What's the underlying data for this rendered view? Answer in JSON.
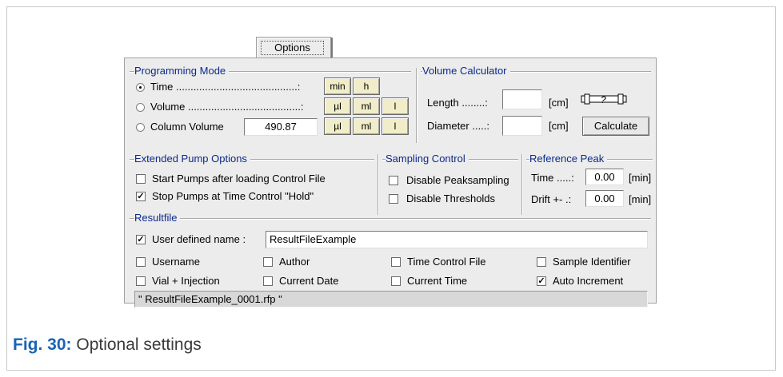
{
  "tab": {
    "label": "Options"
  },
  "programming_mode": {
    "title": "Programming Mode",
    "time_label": "Time ..........................................:",
    "volume_label": "Volume .......................................:",
    "column_volume_label": "Column Volume",
    "column_volume_value": "490.87",
    "selected": "Time",
    "time_units": [
      "min",
      "h"
    ],
    "volume_units": [
      "µl",
      "ml",
      "l"
    ],
    "column_units": [
      "µl",
      "ml",
      "l"
    ]
  },
  "volume_calculator": {
    "title": "Volume Calculator",
    "length_label": "Length ........:",
    "length_value": "",
    "length_unit": "[cm]",
    "diameter_label": "Diameter .....:",
    "diameter_value": "",
    "diameter_unit": "[cm]",
    "calculate_label": "Calculate",
    "column_icon_name": "column-icon"
  },
  "extended_pump": {
    "title": "Extended Pump Options",
    "start_label": "Start Pumps after loading Control File",
    "start_checked": false,
    "stop_label": "Stop Pumps at Time Control \"Hold\"",
    "stop_checked": true
  },
  "sampling_control": {
    "title": "Sampling Control",
    "disable_peak_label": "Disable Peaksampling",
    "disable_thresholds_label": "Disable Thresholds"
  },
  "reference_peak": {
    "title": "Reference Peak",
    "time_label": "Time .....:",
    "time_value": "0.00",
    "time_unit": "[min]",
    "drift_label": "Drift +- .:",
    "drift_value": "0.00",
    "drift_unit": "[min]"
  },
  "resultfile": {
    "title": "Resultfile",
    "user_defined_label": "User defined name :",
    "user_defined_checked": true,
    "name_value": "ResultFileExample",
    "options": [
      {
        "label": "Username",
        "checked": false
      },
      {
        "label": "Author",
        "checked": false
      },
      {
        "label": "Time Control File",
        "checked": false
      },
      {
        "label": "Sample Identifier",
        "checked": false
      },
      {
        "label": "Vial + Injection",
        "checked": false
      },
      {
        "label": "Current Date",
        "checked": false
      },
      {
        "label": "Current Time",
        "checked": false
      },
      {
        "label": "Auto Increment",
        "checked": true
      }
    ],
    "preview": "\" ResultFileExample_0001.rfp \""
  },
  "caption": {
    "number": "Fig. 30:",
    "text": "Optional settings"
  },
  "colors": {
    "section_title": "#0a2a8a",
    "caption_number": "#1a64b4",
    "unit_button": "#f0edc8"
  }
}
